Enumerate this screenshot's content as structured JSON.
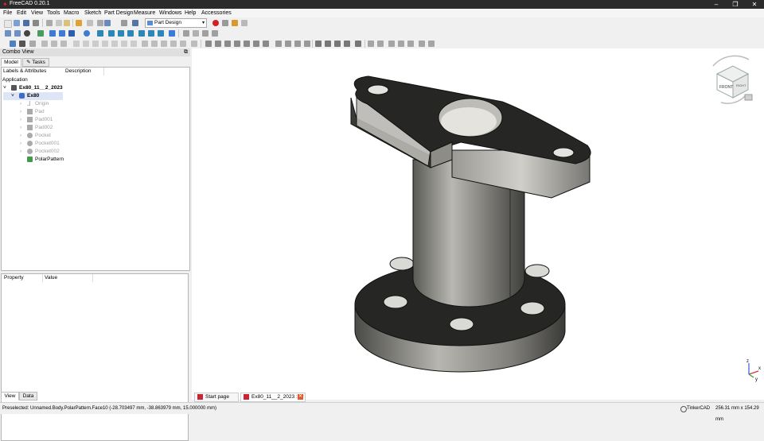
{
  "window": {
    "title": "FreeCAD 0.20.1"
  },
  "menubar": [
    "File",
    "Edit",
    "View",
    "Tools",
    "Macro",
    "Sketch",
    "Part Design",
    "Measure",
    "Windows",
    "Help",
    "Accessories"
  ],
  "toolbar": {
    "workbench": "Part Design"
  },
  "combo": {
    "title": "Combo View",
    "tabs": [
      "Model",
      "Tasks"
    ],
    "tree": {
      "columns": [
        "Labels & Attributes",
        "Description"
      ],
      "root": "Application",
      "items": [
        {
          "label": "Ex80_11__2_2023",
          "level": 0
        },
        {
          "label": "Ex80",
          "level": 1
        },
        {
          "label": "Origin",
          "level": 2,
          "dim": true
        },
        {
          "label": "Pad",
          "level": 2,
          "dim": true
        },
        {
          "label": "Pad001",
          "level": 2,
          "dim": true
        },
        {
          "label": "Pad002",
          "level": 2,
          "dim": true
        },
        {
          "label": "Pocket",
          "level": 2,
          "dim": true
        },
        {
          "label": "Pocket001",
          "level": 2,
          "dim": true
        },
        {
          "label": "Pocket002",
          "level": 2,
          "dim": true
        },
        {
          "label": "PolarPattern",
          "level": 2,
          "dim": false
        }
      ]
    },
    "props": {
      "columns": [
        "Property",
        "Value"
      ],
      "tabs": [
        "View",
        "Data"
      ]
    }
  },
  "viewport": {
    "navcube": {
      "front": "FRONT",
      "right": "RIGHT"
    },
    "axis": [
      "x",
      "y",
      "z"
    ]
  },
  "doc_tabs": [
    "Start page",
    "Ex80_11__2_2023 : 1*"
  ],
  "status": {
    "message": "Preselected: Unnamed.Body.PolarPattern.Face10 (-28.703497 mm, -38.863979 mm, 15.000000 mm)",
    "nav_style": "TinkerCAD",
    "dimensions": "256.31 mm x 154.29 mm"
  }
}
